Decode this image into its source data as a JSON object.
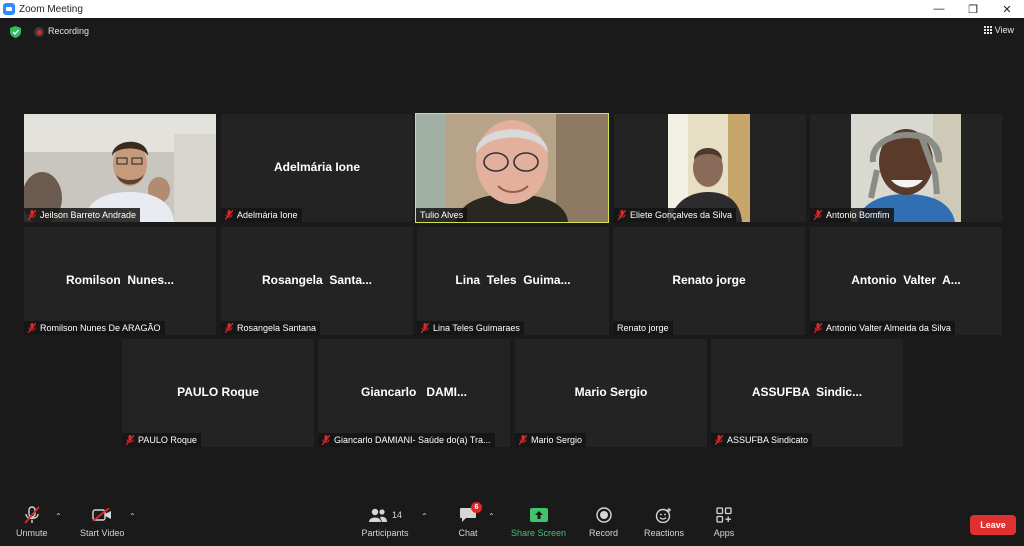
{
  "window": {
    "title": "Zoom Meeting",
    "minimize": "—",
    "restore": "❐",
    "close": "✕"
  },
  "topbar": {
    "recording_label": "Recording",
    "view_label": "View"
  },
  "participants": [
    {
      "label": "Jeilson Barreto Andrade",
      "big_name": "",
      "muted": true,
      "video": true
    },
    {
      "label": "Adelmária Ione",
      "big_name": "Adelmária Ione",
      "muted": true,
      "video": false
    },
    {
      "label": "Tulio Alves",
      "big_name": "",
      "muted": false,
      "video": true,
      "active_speaker": true
    },
    {
      "label": "Eliete Gonçalves da Silva",
      "big_name": "",
      "muted": true,
      "video": true
    },
    {
      "label": "Antonio Bomfim",
      "big_name": "",
      "muted": true,
      "video": true
    },
    {
      "label": "Romilson Nunes De ARAGÃO",
      "big_name": "Romilson  Nunes...",
      "muted": true,
      "video": false
    },
    {
      "label": "Rosangela Santana",
      "big_name": "Rosangela  Santa...",
      "muted": true,
      "video": false
    },
    {
      "label": "Lina Teles Guimaraes",
      "big_name": "Lina  Teles  Guima...",
      "muted": true,
      "video": false
    },
    {
      "label": "Renato jorge",
      "big_name": "Renato jorge",
      "muted": false,
      "video": false
    },
    {
      "label": "Antonio Valter Almeida da Silva",
      "big_name": "Antonio  Valter  A...",
      "muted": true,
      "video": false
    },
    {
      "label": "PAULO Roque",
      "big_name": "PAULO Roque",
      "muted": true,
      "video": false
    },
    {
      "label": "Giancarlo  DAMIANI- Saúde do(a) Tra...",
      "big_name": "Giancarlo   DAMI...",
      "muted": true,
      "video": false
    },
    {
      "label": "Mario Sergio",
      "big_name": "Mario Sergio",
      "muted": true,
      "video": false
    },
    {
      "label": "ASSUFBA Sindicato",
      "big_name": "ASSUFBA  Sindic...",
      "muted": true,
      "video": false
    }
  ],
  "toolbar": {
    "unmute": "Unmute",
    "start_video": "Start Video",
    "participants": "Participants",
    "participants_count": "14",
    "chat": "Chat",
    "chat_badge": "6",
    "share_screen": "Share Screen",
    "record": "Record",
    "reactions": "Reactions",
    "apps": "Apps",
    "leave": "Leave"
  },
  "colors": {
    "active_speaker_border": "#d4e157",
    "share_green": "#3ec46d",
    "leave_red": "#e03131",
    "mute_red": "#e02828"
  }
}
